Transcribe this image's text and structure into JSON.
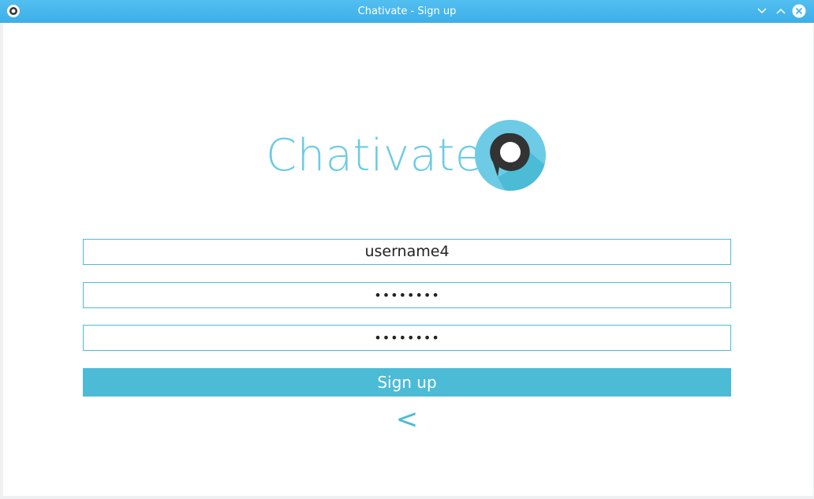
{
  "window": {
    "title": "Chativate - Sign up",
    "icon": "chativate-app-icon",
    "controls": [
      "minimize-icon",
      "maximize-icon",
      "close-icon"
    ]
  },
  "logo": {
    "text": "Chativate",
    "icon": "speech-bubble-icon",
    "colors": {
      "text": "#6dcbe5",
      "circle": "#6dcbe5",
      "shadow": "#4bbbd6",
      "bubble": "#333333"
    }
  },
  "form": {
    "username": {
      "value": "username4"
    },
    "password": {
      "value": "••••••••"
    },
    "confirm_password": {
      "value": "••••••••"
    },
    "signup_label": "Sign up",
    "back_label": "<"
  },
  "colors": {
    "accent": "#4bbbd6",
    "titlebar": "#3daee9"
  }
}
